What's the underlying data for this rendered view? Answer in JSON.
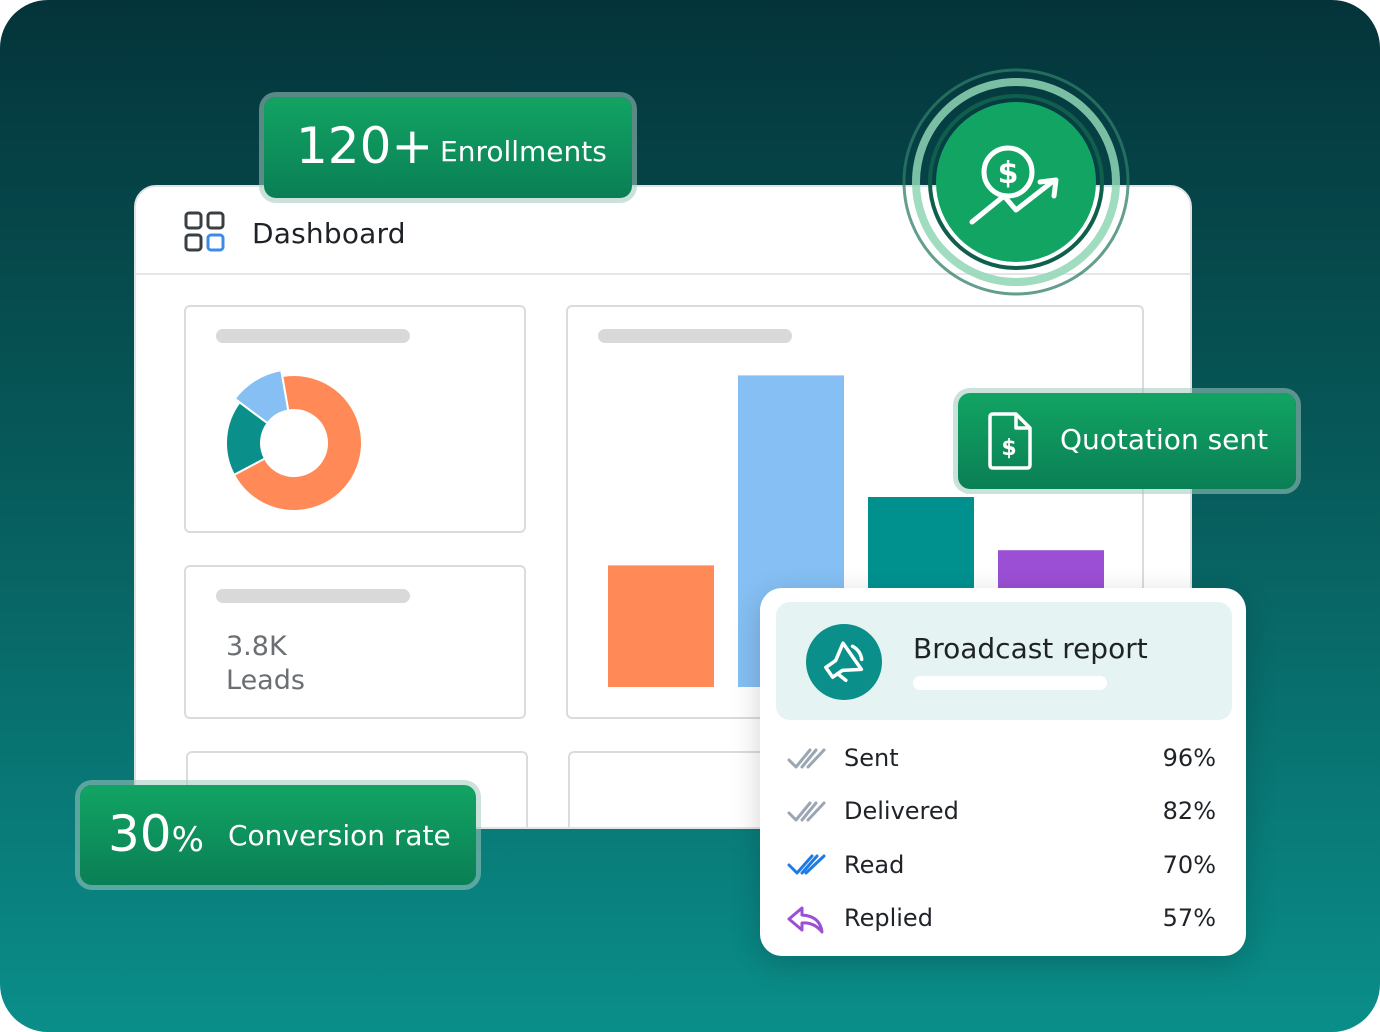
{
  "dashboard": {
    "title": "Dashboard",
    "leads_value": "3.8K",
    "leads_label": "Leads"
  },
  "colors": {
    "orange": "#ff8a57",
    "light_blue": "#85bff3",
    "teal": "#00918f",
    "purple": "#9b4fd4",
    "pill_green": "#0d8f5c"
  },
  "chart_data": [
    {
      "type": "pie",
      "labels": [],
      "values": [
        70,
        18,
        12
      ],
      "colors": [
        "#ff8a57",
        "#0b8f8a",
        "#85bff3"
      ]
    },
    {
      "type": "bar",
      "categories": [],
      "values": [
        32,
        82,
        50,
        36
      ],
      "colors": [
        "#ff8a57",
        "#85bff3",
        "#00918f",
        "#9b4fd4"
      ],
      "ylim": [
        0,
        100
      ]
    }
  ],
  "enrollments": {
    "value": "120+",
    "label": "Enrollments"
  },
  "conversion": {
    "value": "30",
    "unit": "%",
    "label": "Conversion rate"
  },
  "quotation": {
    "label": "Quotation sent",
    "icon": "dollar-document-icon"
  },
  "money_badge": {
    "icon": "dollar-growth-icon"
  },
  "broadcast": {
    "title": "Broadcast report",
    "icon": "megaphone-icon",
    "rows": [
      {
        "label": "Sent",
        "value": "96%",
        "icon": "double-check-gray-icon"
      },
      {
        "label": "Delivered",
        "value": "82%",
        "icon": "double-check-gray-icon"
      },
      {
        "label": "Read",
        "value": "70%",
        "icon": "double-check-blue-icon"
      },
      {
        "label": "Replied",
        "value": "57%",
        "icon": "reply-icon"
      }
    ]
  }
}
